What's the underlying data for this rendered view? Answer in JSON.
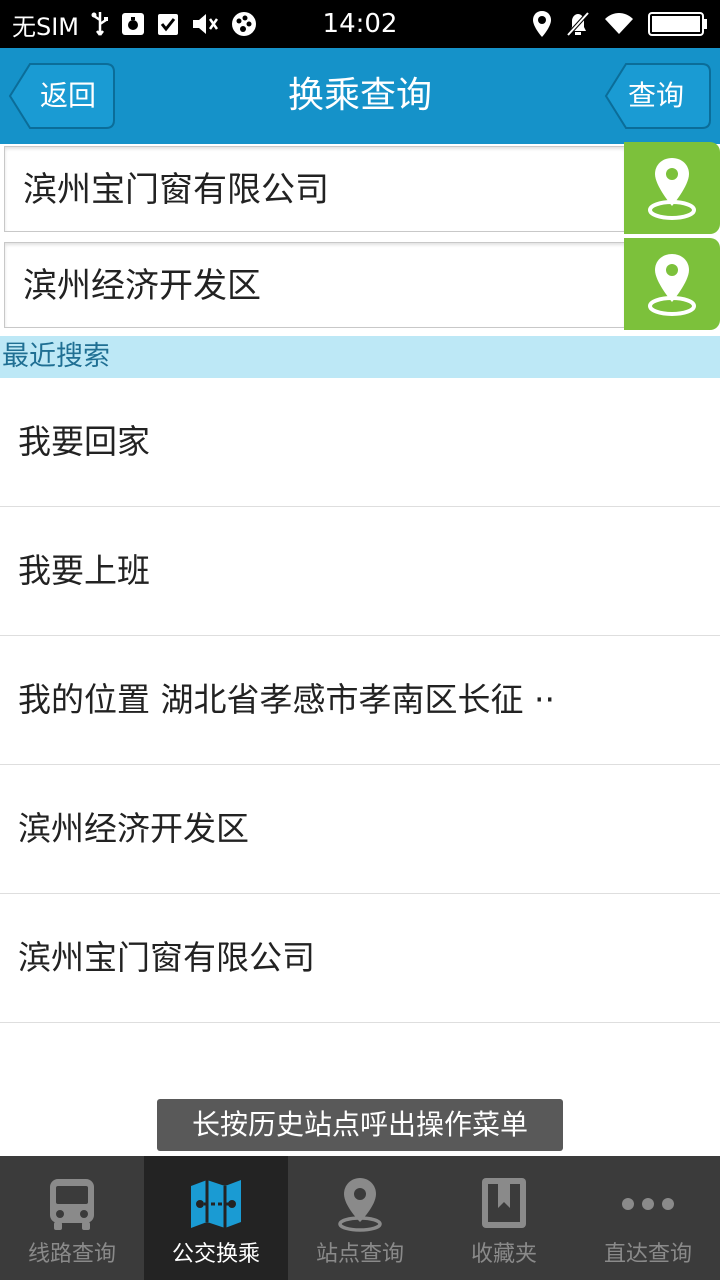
{
  "status_bar": {
    "carrier": "无SIM",
    "time": "14:02",
    "icons": [
      "usb-icon",
      "debug-icon",
      "check-icon",
      "mute-icon",
      "palette-icon",
      "location-icon",
      "alarm-off-icon",
      "wifi-icon",
      "battery-icon"
    ]
  },
  "header": {
    "title": "换乘查询",
    "back_label": "返回",
    "query_label": "查询",
    "color": "#1592c9"
  },
  "inputs": {
    "start": "滨州宝门窗有限公司",
    "end": "滨州经济开发区",
    "locate_color": "#7cc13b"
  },
  "recent": {
    "header": "最近搜索",
    "items": [
      "我要回家",
      "我要上班",
      "我的位置 湖北省孝感市孝南区长征 ··",
      "滨州经济开发区",
      "滨州宝门窗有限公司"
    ]
  },
  "toast": "长按历史站点呼出操作菜单",
  "bottom_nav": {
    "active_index": 1,
    "tabs": [
      {
        "label": "线路查询",
        "icon": "bus-icon"
      },
      {
        "label": "公交换乘",
        "icon": "map-transfer-icon"
      },
      {
        "label": "站点查询",
        "icon": "location-pin-icon"
      },
      {
        "label": "收藏夹",
        "icon": "bookmark-icon"
      },
      {
        "label": "直达查询",
        "icon": "more-dots-icon"
      }
    ]
  }
}
